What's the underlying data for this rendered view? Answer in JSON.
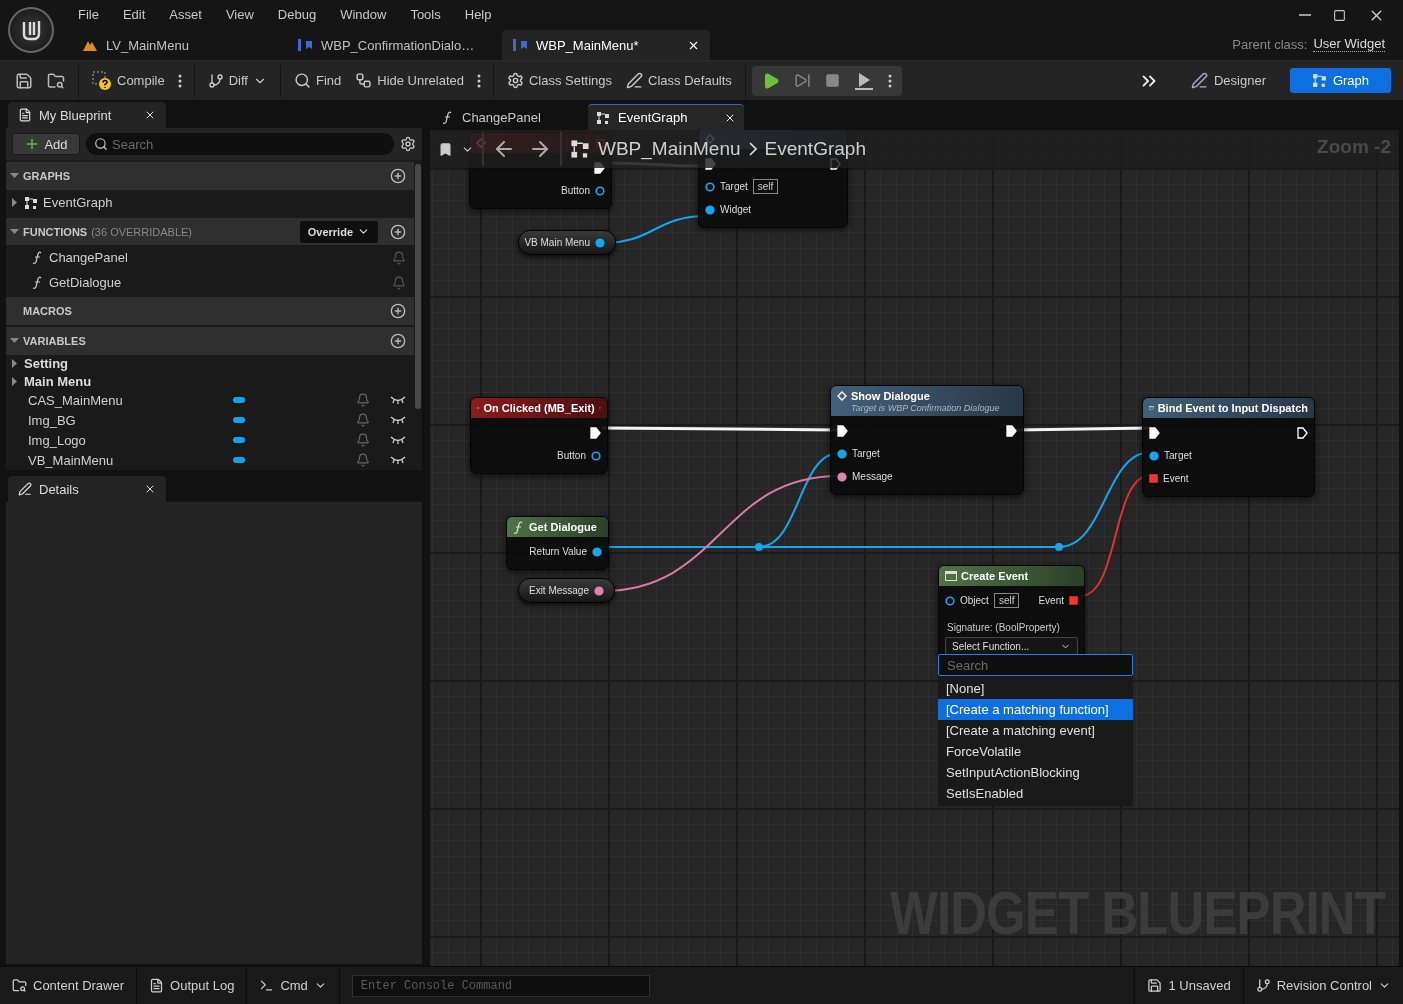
{
  "title_bar": {
    "menu": [
      "File",
      "Edit",
      "Asset",
      "View",
      "Debug",
      "Window",
      "Tools",
      "Help"
    ],
    "doc_tabs": [
      {
        "kind": "level",
        "label": "LV_MainMenu",
        "selected": false
      },
      {
        "kind": "widget",
        "label": "WBP_ConfirmationDialo…",
        "selected": false
      },
      {
        "kind": "widget",
        "label": "WBP_MainMenu*",
        "selected": true
      }
    ],
    "parent_class_label": "Parent class:",
    "parent_class": "User Widget"
  },
  "toolbar": {
    "items": [
      {
        "kind": "save"
      },
      {
        "kind": "browse"
      },
      {
        "kind": "separator"
      },
      {
        "kind": "compile",
        "label": "Compile"
      },
      {
        "kind": "more"
      },
      {
        "kind": "separator"
      },
      {
        "kind": "diff",
        "label": "Diff"
      },
      {
        "kind": "separator"
      },
      {
        "kind": "find",
        "label": "Find"
      },
      {
        "kind": "hide",
        "label": "Hide Unrelated"
      },
      {
        "kind": "more"
      },
      {
        "kind": "separator"
      },
      {
        "kind": "class_settings",
        "label": "Class Settings"
      },
      {
        "kind": "class_defaults",
        "label": "Class Defaults"
      },
      {
        "kind": "separator"
      }
    ],
    "play_controls": [
      {
        "kind": "play"
      },
      {
        "kind": "advance"
      },
      {
        "kind": "stop"
      },
      {
        "kind": "simulate"
      },
      {
        "kind": "more"
      }
    ],
    "modes": [
      {
        "kind": "designer",
        "label": "Designer",
        "selected": false
      },
      {
        "kind": "graph",
        "label": "Graph",
        "selected": true
      }
    ]
  },
  "my_blueprint": {
    "tab": "My Blueprint",
    "add_button": "Add",
    "search_placeholder": "Search",
    "sections": [
      {
        "kind": "graphs",
        "title": "GRAPHS",
        "expanded": true,
        "items": [
          {
            "kind": "graph",
            "label": "EventGraph",
            "expanded": false
          }
        ]
      },
      {
        "kind": "functions",
        "title": "FUNCTIONS",
        "note": "(36 OVERRIDABLE)",
        "override": "Override",
        "expanded": true,
        "items": [
          {
            "kind": "function",
            "label": "ChangePanel"
          },
          {
            "kind": "function",
            "label": "GetDialogue"
          }
        ]
      },
      {
        "kind": "empty",
        "title": "MACROS"
      },
      {
        "kind": "variables",
        "title": "VARIABLES",
        "expanded": true,
        "items": [
          {
            "kind": "category",
            "label": "Setting",
            "expanded": false
          },
          {
            "kind": "category",
            "label": "Main Menu",
            "expanded": false
          },
          {
            "kind": "variable",
            "label": "CAS_MainMenu"
          },
          {
            "kind": "variable",
            "label": "Img_BG"
          },
          {
            "kind": "variable",
            "label": "Img_Logo"
          },
          {
            "kind": "variable",
            "label": "VB_MainMenu"
          }
        ]
      }
    ]
  },
  "details": {
    "tab": "Details"
  },
  "graph": {
    "tabs": [
      {
        "kind": "function",
        "label": "ChangePanel",
        "selected": false
      },
      {
        "kind": "graph",
        "label": "EventGraph",
        "selected": true
      }
    ],
    "breadcrumb": [
      "WBP_MainMenu",
      "EventGraph"
    ],
    "zoom": "Zoom -2",
    "watermark": "WIDGET BLUEPRINT",
    "nodes": [
      {
        "kind": "event",
        "outputs": [
          {
            "kind": "exec",
            "connected": true
          },
          {
            "kind": "object",
            "label": "Button",
            "connected": false
          }
        ]
      },
      {
        "kind": "call",
        "inputs": [
          {
            "kind": "exec",
            "connected": true
          },
          {
            "kind": "object",
            "label": "Target",
            "default": "self",
            "connected": false
          },
          {
            "kind": "object",
            "label": "Widget",
            "connected": true
          }
        ],
        "outputs": [
          {
            "kind": "exec",
            "connected": false
          }
        ]
      },
      {
        "kind": "variable",
        "outputs": [
          {
            "kind": "object",
            "label": "VB Main Menu",
            "connected": true
          }
        ]
      },
      {
        "kind": "event",
        "title": "On Clicked (MB_Exit)",
        "outputs": [
          {
            "kind": "exec",
            "connected": true
          },
          {
            "kind": "object",
            "label": "Button",
            "connected": false
          }
        ]
      },
      {
        "kind": "call",
        "title": "Show Dialogue",
        "subtitle": "Target is WBP Confirmation Dialogue",
        "inputs": [
          {
            "kind": "exec",
            "connected": true
          },
          {
            "kind": "object",
            "label": "Target",
            "connected": true
          },
          {
            "kind": "text",
            "label": "Message",
            "connected": true
          }
        ],
        "outputs": [
          {
            "kind": "exec",
            "connected": true
          }
        ]
      },
      {
        "kind": "bind",
        "title": "Bind Event to Input Dispatch",
        "inputs": [
          {
            "kind": "exec",
            "connected": true
          },
          {
            "kind": "object",
            "label": "Target",
            "connected": true
          },
          {
            "kind": "delegate",
            "label": "Event",
            "connected": true
          }
        ],
        "outputs": [
          {
            "kind": "exec",
            "connected": false
          }
        ]
      },
      {
        "kind": "pure",
        "title": "Get Dialogue",
        "outputs": [
          {
            "kind": "object",
            "label": "Return Value",
            "connected": true
          }
        ]
      },
      {
        "kind": "variable",
        "outputs": [
          {
            "kind": "text",
            "label": "Exit Message",
            "connected": true
          }
        ]
      },
      {
        "kind": "create",
        "title": "Create Event",
        "signature": "Signature: (BoolProperty)",
        "function_select": "Select Function...",
        "inputs": [
          {
            "kind": "object",
            "label": "Object",
            "default": "self",
            "connected": false
          }
        ],
        "outputs": [
          {
            "kind": "delegate",
            "label": "Event",
            "connected": true
          }
        ]
      }
    ],
    "dropdown": {
      "search_placeholder": "Search",
      "options": [
        {
          "label": "[None]",
          "selected": false
        },
        {
          "label": "[Create a matching function]",
          "selected": true
        },
        {
          "label": "[Create a matching event]",
          "selected": false
        },
        {
          "label": "ForceVolatile",
          "selected": false
        },
        {
          "label": "SetInputActionBlocking",
          "selected": false
        },
        {
          "label": "SetIsEnabled",
          "selected": false
        }
      ]
    }
  },
  "status_bar": {
    "left": [
      {
        "kind": "content_drawer",
        "label": "Content Drawer"
      },
      {
        "kind": "output_log",
        "label": "Output Log"
      },
      {
        "kind": "cmd",
        "label": "Cmd"
      }
    ],
    "console_placeholder": "Enter Console Command",
    "right": [
      {
        "kind": "unsaved",
        "label": "1 Unsaved"
      },
      {
        "kind": "revision",
        "label": "Revision Control"
      }
    ]
  }
}
